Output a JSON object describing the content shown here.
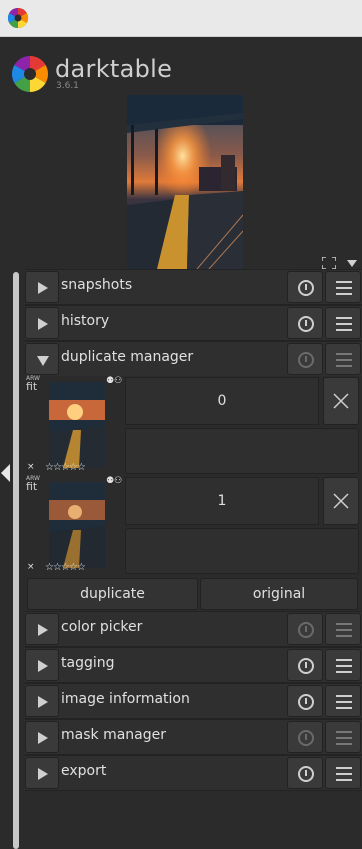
{
  "app": {
    "name": "darktable",
    "version": "3.6.1"
  },
  "modules": [
    {
      "label": "snapshots",
      "expanded": false,
      "dim": false
    },
    {
      "label": "history",
      "expanded": false,
      "dim": false
    },
    {
      "label": "duplicate manager",
      "expanded": true,
      "dim": true
    },
    {
      "label": "color picker",
      "expanded": false,
      "dim": true
    },
    {
      "label": "tagging",
      "expanded": false,
      "dim": false
    },
    {
      "label": "image information",
      "expanded": false,
      "dim": false
    },
    {
      "label": "mask manager",
      "expanded": false,
      "dim": true
    },
    {
      "label": "export",
      "expanded": false,
      "dim": false
    }
  ],
  "duplicates": [
    {
      "version": "0",
      "fit": "fit",
      "type": "ARW",
      "reject": "×",
      "stars": "☆☆☆☆☆",
      "badge": "⚉⚇"
    },
    {
      "version": "1",
      "fit": "fit",
      "type": "ARW",
      "reject": "×",
      "stars": "☆☆☆☆☆",
      "badge": "⚉⚇"
    }
  ],
  "duplicate_actions": {
    "duplicate": "duplicate",
    "original": "original"
  },
  "icons": {
    "app": "darktable-aperture-icon",
    "expand": "fullscreen-icon",
    "collapse": "collapse-arrow-icon",
    "reset": "reset-icon",
    "presets": "presets-menu-icon",
    "delete": "close-icon"
  }
}
